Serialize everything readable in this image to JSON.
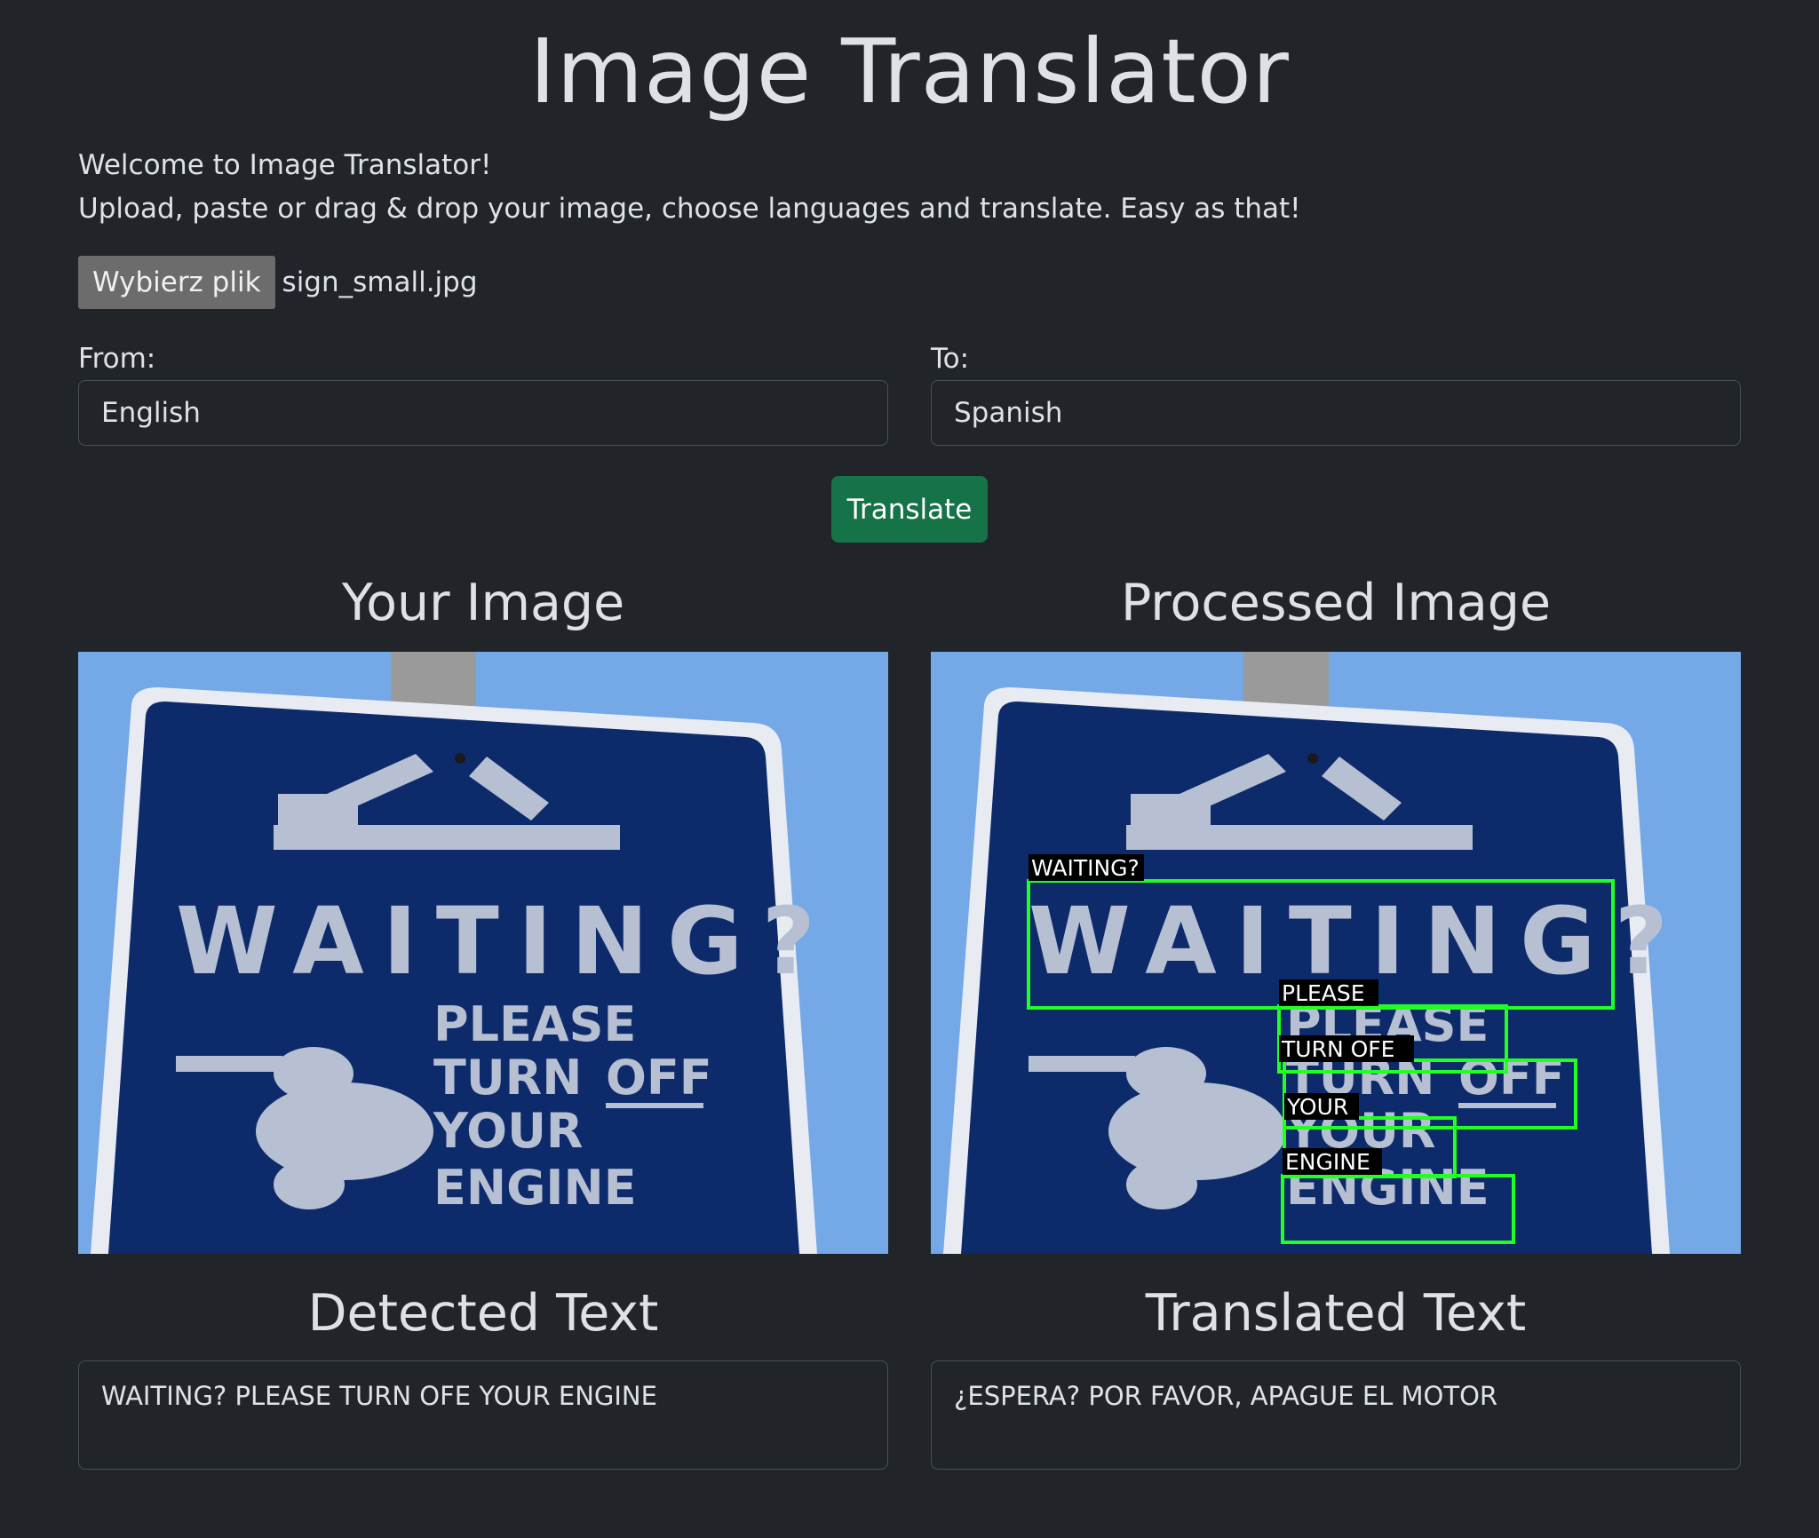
{
  "app": {
    "title": "Image Translator",
    "intro_line1": "Welcome to Image Translator!",
    "intro_line2": "Upload, paste or drag & drop your image, choose languages and translate. Easy as that!"
  },
  "file_input": {
    "button_label": "Wybierz plik",
    "file_name": "sign_small.jpg"
  },
  "languages": {
    "from_label": "From:",
    "from_value": "English",
    "to_label": "To:",
    "to_value": "Spanish"
  },
  "actions": {
    "translate_label": "Translate"
  },
  "images": {
    "original_heading": "Your Image",
    "processed_heading": "Processed Image",
    "sign_text": {
      "line1": "WAITING?",
      "line2": "PLEASE",
      "line3a": "TURN",
      "line3b": "OFF",
      "line4": "YOUR",
      "line5": "ENGINE"
    },
    "detections": [
      {
        "label": "WAITING?"
      },
      {
        "label": "PLEASE"
      },
      {
        "label": "TURN OFE"
      },
      {
        "label": "YOUR"
      },
      {
        "label": "ENGINE"
      }
    ],
    "box_color": "#22ff22"
  },
  "results": {
    "detected_heading": "Detected Text",
    "detected_text": "WAITING? PLEASE TURN OFE YOUR ENGINE",
    "translated_heading": "Translated Text",
    "translated_text": "¿ESPERA? POR FAVOR, APAGUE EL MOTOR"
  },
  "colors": {
    "background": "#212529",
    "text": "#dee2e6",
    "translate_button": "#157347",
    "file_button": "#6c6c6c",
    "sky": "#6fa3e0",
    "sign_blue": "#0d2a6b",
    "sign_text": "#b7c0d2"
  }
}
